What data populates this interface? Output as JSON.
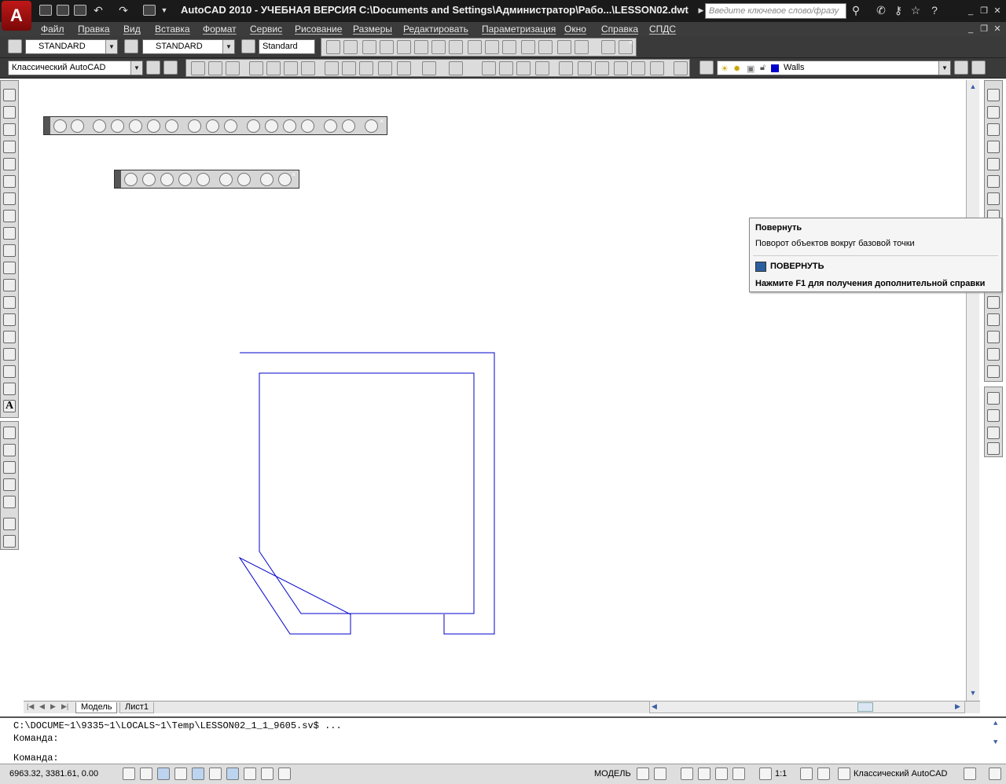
{
  "window": {
    "title": "AutoCAD 2010 - УЧЕБНАЯ ВЕРСИЯ    C:\\Documents and Settings\\Администратор\\Рабо...\\LESSON02.dwt",
    "app_logo": "A",
    "search_placeholder": "Введите ключевое слово/фразу",
    "buttons": [
      "minimize-icon",
      "restore-icon",
      "close-icon"
    ]
  },
  "menu": {
    "items": [
      "Файл",
      "Правка",
      "Вид",
      "Вставка",
      "Формат",
      "Сервис",
      "Рисование",
      "Размеры",
      "Редактировать",
      "Параметризация",
      "Окно",
      "Справка",
      "СПДС"
    ]
  },
  "styles_toolbar": {
    "text_style": "STANDARD",
    "dim_style": "STANDARD",
    "table_style": "Standard"
  },
  "workspace_toolbar": {
    "workspace": "Классический AutoCAD"
  },
  "layers_toolbar": {
    "layer": "Walls",
    "layer_color": "#0000cc"
  },
  "tooltip": {
    "title": "Повернуть",
    "description": "Поворот объектов вокруг базовой точки",
    "command": "ПОВЕРНУТЬ",
    "help": "Нажмите F1 для получения дополнительной справки"
  },
  "tabs": {
    "model": "Модель",
    "layout1": "Лист1"
  },
  "command_line": {
    "line1": "C:\\DOCUME~1\\9335~1\\LOCALS~1\\Temp\\LESSON02_1_1_9605.sv$ ...",
    "line2": "Команда:",
    "line3": "Команда:"
  },
  "status_bar": {
    "coordinates": "6963.32,  3381.61, 0.00",
    "mode": "МОДЕЛЬ",
    "annotation_scale": "1:1",
    "workspace": "Классический AutoCAD"
  },
  "drawing": {
    "stroke_color": "#0000cc"
  }
}
